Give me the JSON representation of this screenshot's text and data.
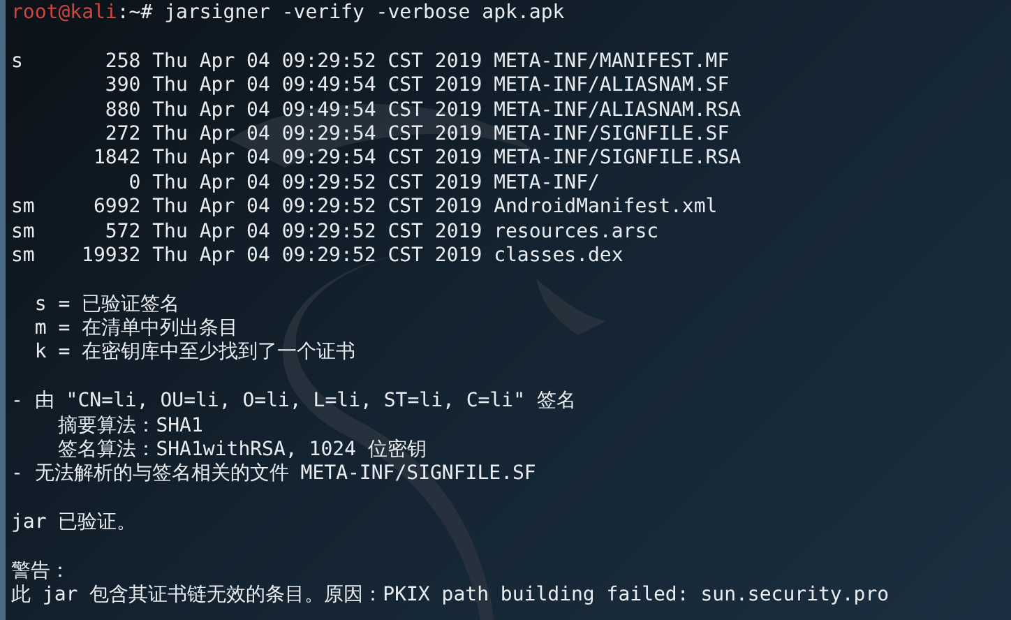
{
  "prompt": {
    "user": "root@kali",
    "suffix": ":~#",
    "command": "jarsigner -verify -verbose apk.apk"
  },
  "entries": [
    {
      "flags": "s",
      "size": "258",
      "date": "Thu Apr 04 09:29:52 CST 2019",
      "name": "META-INF/MANIFEST.MF"
    },
    {
      "size": "390",
      "date": "Thu Apr 04 09:49:54 CST 2019",
      "name": "META-INF/ALIASNAM.SF"
    },
    {
      "size": "880",
      "date": "Thu Apr 04 09:49:54 CST 2019",
      "name": "META-INF/ALIASNAM.RSA"
    },
    {
      "size": "272",
      "date": "Thu Apr 04 09:29:54 CST 2019",
      "name": "META-INF/SIGNFILE.SF"
    },
    {
      "size": "1842",
      "date": "Thu Apr 04 09:29:54 CST 2019",
      "name": "META-INF/SIGNFILE.RSA"
    },
    {
      "size": "0",
      "date": "Thu Apr 04 09:29:52 CST 2019",
      "name": "META-INF/"
    },
    {
      "flags": "sm",
      "size": "6992",
      "date": "Thu Apr 04 09:29:52 CST 2019",
      "name": "AndroidManifest.xml"
    },
    {
      "flags": "sm",
      "size": "572",
      "date": "Thu Apr 04 09:29:52 CST 2019",
      "name": "resources.arsc"
    },
    {
      "flags": "sm",
      "size": "19932",
      "date": "Thu Apr 04 09:29:52 CST 2019",
      "name": "classes.dex"
    }
  ],
  "legend": [
    "s = 已验证签名",
    "m = 在清单中列出条目",
    "k = 在密钥库中至少找到了一个证书"
  ],
  "details": [
    {
      "kind": "item",
      "text": "- 由 \"CN=li, OU=li, O=li, L=li, ST=li, C=li\" 签名"
    },
    {
      "kind": "sub",
      "text": "摘要算法：SHA1"
    },
    {
      "kind": "sub",
      "text": "签名算法：SHA1withRSA, 1024 位密钥"
    },
    {
      "kind": "item",
      "text": "- 无法解析的与签名相关的文件 META-INF/SIGNFILE.SF"
    }
  ],
  "result": "jar 已验证。",
  "warning": {
    "heading": "警告：",
    "lines": [
      "此 jar 包含其证书链无效的条目。原因：PKIX path building failed: sun.security.pro"
    ]
  }
}
